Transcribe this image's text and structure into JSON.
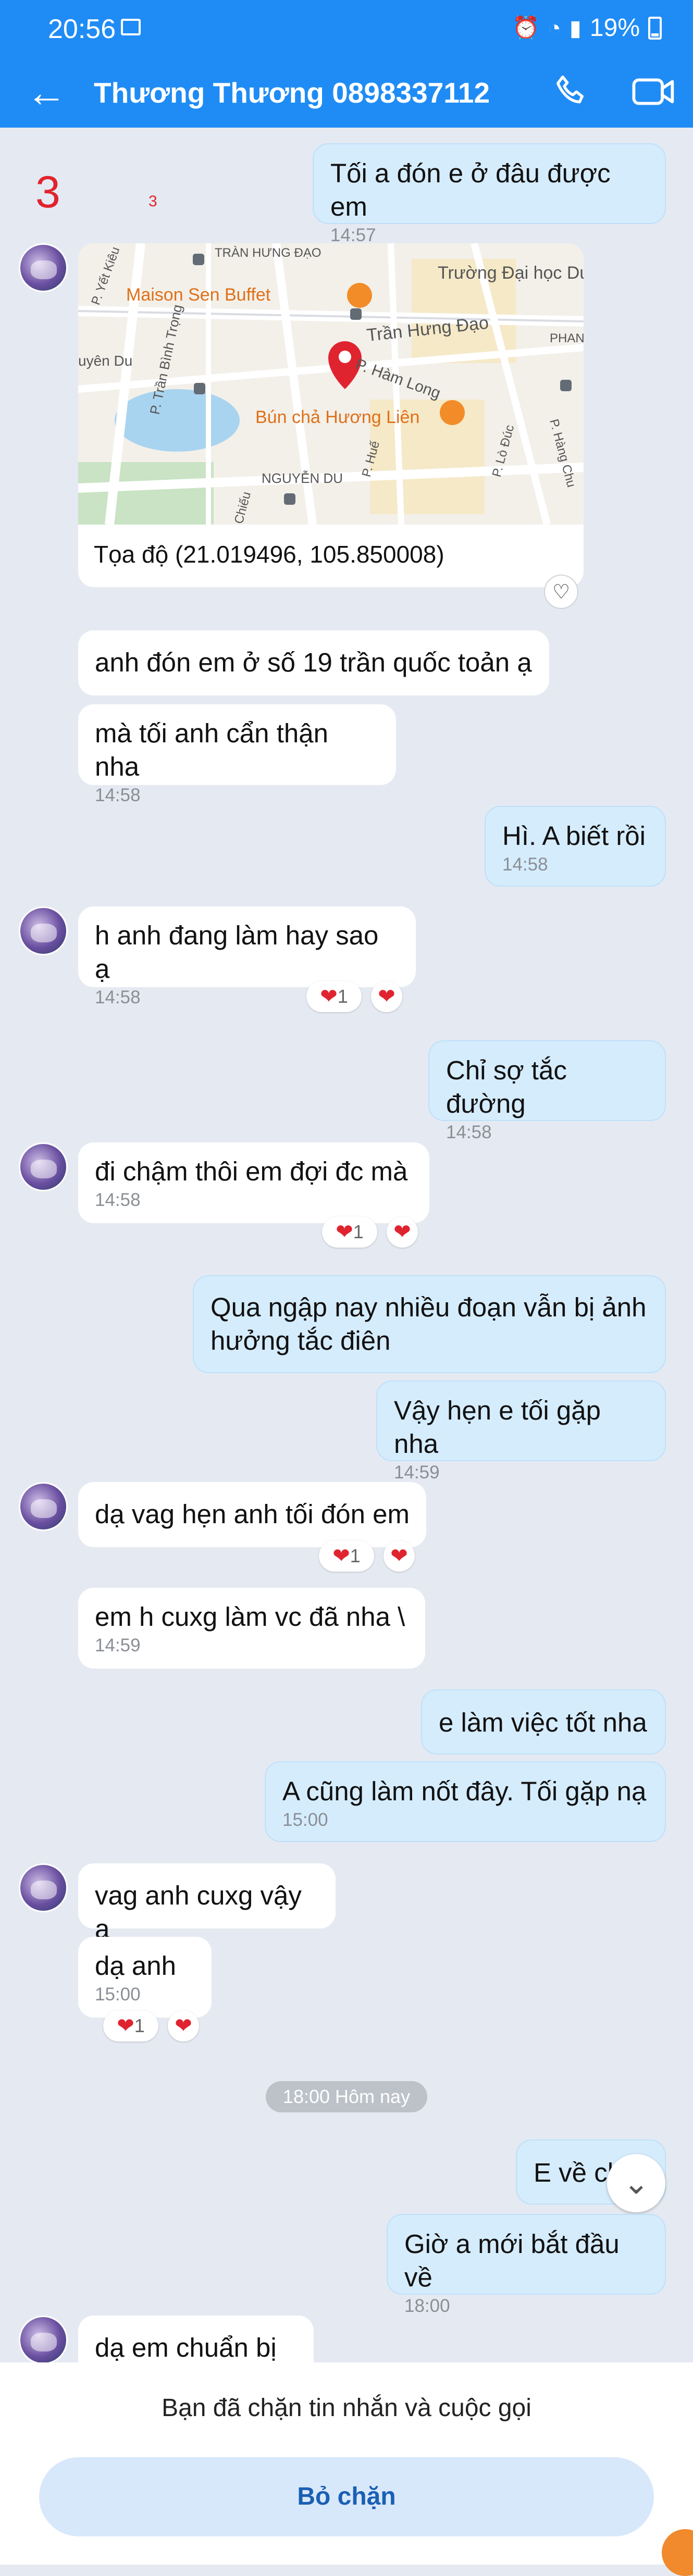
{
  "status_bar": {
    "time": "20:56",
    "battery": "19%"
  },
  "header": {
    "title": "Thương Thương 0898337112"
  },
  "overlay_marks": {
    "big": "3",
    "small": "3"
  },
  "map": {
    "labels": [
      "TRÀN HƯNG ĐẠO",
      "P. Yết Kiêu",
      "Maison Sen Buffet",
      "Trường Đại học Dược Hà Nội",
      "PHAN TR",
      "Trần Hưng Đạo",
      "uyên Du",
      "P. Trần Bình Trọng",
      "P. Hàm Long",
      "Bún chả Hương Liên",
      "P. Hàng Chu",
      "P. Huế",
      "P. Lò Đúc",
      "NGUYỄN DU",
      "Chiếu"
    ],
    "coords": "Tọa độ (21.019496, 105.850008)"
  },
  "messages": [
    {
      "side": "out",
      "text": "Tối a đón e ở đâu được em",
      "time": "14:57"
    },
    {
      "side": "in",
      "text": "anh đón em ở số 19 trần quốc toản ạ",
      "time": ""
    },
    {
      "side": "in",
      "text": "mà tối anh cẩn thận nha",
      "time": "14:58"
    },
    {
      "side": "out",
      "text": "Hì. A biết rồi",
      "time": "14:58"
    },
    {
      "side": "in",
      "text": "h anh đang làm hay sao ạ",
      "time": "14:58"
    },
    {
      "side": "out",
      "text": "Chỉ sợ tắc đường",
      "time": "14:58"
    },
    {
      "side": "in",
      "text": "đi chậm thôi em đợi đc mà",
      "time": "14:58"
    },
    {
      "side": "out",
      "text": "Qua ngập nay nhiều đoạn vẫn bị ảnh hưởng tắc điên",
      "time": ""
    },
    {
      "side": "out",
      "text": "Vậy hẹn e tối gặp nha",
      "time": "14:59"
    },
    {
      "side": "in",
      "text": "dạ vag hẹn anh tối đón em",
      "time": ""
    },
    {
      "side": "in",
      "text": "em h cuxg làm vc đã nha \\",
      "time": "14:59"
    },
    {
      "side": "out",
      "text": "e làm việc tốt nha",
      "time": ""
    },
    {
      "side": "out",
      "text": "A cũng làm nốt đây. Tối gặp nạ",
      "time": "15:00"
    },
    {
      "side": "in",
      "text": "vag anh cuxg vậy ạ",
      "time": ""
    },
    {
      "side": "in",
      "text": "dạ anh",
      "time": "15:00"
    },
    {
      "side": "out",
      "text": "E về ch",
      "time": ""
    },
    {
      "side": "out",
      "text": "Giờ a mới bắt đầu về",
      "time": "18:00"
    },
    {
      "side": "in",
      "text": "dạ em chuẩn bị ạ",
      "time": ""
    }
  ],
  "reactions": {
    "heart_count": "1"
  },
  "date_separator": "18:00 Hôm nay",
  "footer": {
    "blocked_text": "Bạn đã chặn tin nhắn và cuộc gọi",
    "unblock_label": "Bỏ chặn"
  },
  "colors": {
    "header": "#1f8cf5",
    "outgoing": "#d5ecfd",
    "incoming": "#ffffff",
    "background": "#e5eaf2",
    "heart": "#e0242f"
  },
  "icons": [
    "back-arrow-icon",
    "phone-icon",
    "video-call-icon",
    "map-pin-icon",
    "heart-icon",
    "chevron-down-icon"
  ]
}
